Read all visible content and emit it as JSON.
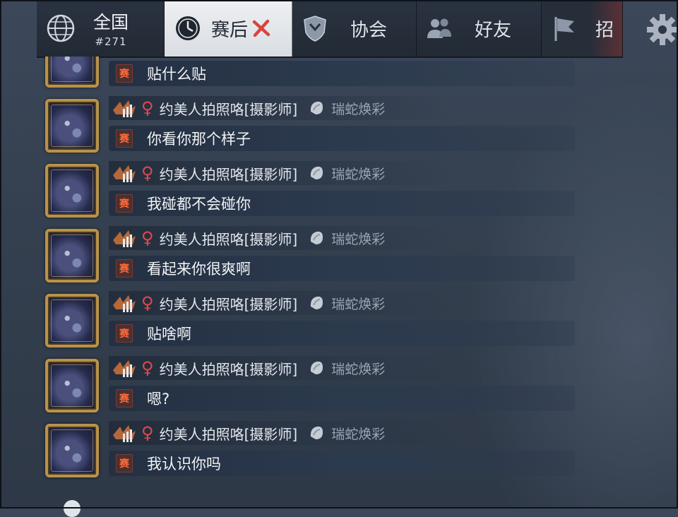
{
  "tabs": {
    "world": {
      "label": "全国",
      "rank": "#271",
      "icon": "globe-icon"
    },
    "post_match": {
      "label": "赛后",
      "icon": "clock-icon",
      "close_icon": "close-icon"
    },
    "association": {
      "label": "协会",
      "icon": "shield-icon"
    },
    "friends": {
      "label": "好友",
      "icon": "friends-icon"
    },
    "recruit": {
      "label": "招",
      "icon": "flag-icon"
    }
  },
  "settings_icon": "gear-icon",
  "colors": {
    "tag_orange": "#ff6a3a",
    "female_red": "#e0484d",
    "frame_gold": "#b9924a"
  },
  "messages": [
    {
      "tag": "赛",
      "text": "贴什么贴"
    },
    {
      "tag": "赛",
      "sender": "约美人拍照咯[摄影师]",
      "skin": "瑞蛇焕彩",
      "text": "你看你那个样子"
    },
    {
      "tag": "赛",
      "sender": "约美人拍照咯[摄影师]",
      "skin": "瑞蛇焕彩",
      "text": "我碰都不会碰你"
    },
    {
      "tag": "赛",
      "sender": "约美人拍照咯[摄影师]",
      "skin": "瑞蛇焕彩",
      "text": "看起来你很爽啊"
    },
    {
      "tag": "赛",
      "sender": "约美人拍照咯[摄影师]",
      "skin": "瑞蛇焕彩",
      "text": "贴啥啊"
    },
    {
      "tag": "赛",
      "sender": "约美人拍照咯[摄影师]",
      "skin": "瑞蛇焕彩",
      "text": "嗯?"
    },
    {
      "tag": "赛",
      "sender": "约美人拍照咯[摄影师]",
      "skin": "瑞蛇焕彩",
      "text": "我认识你吗"
    }
  ]
}
